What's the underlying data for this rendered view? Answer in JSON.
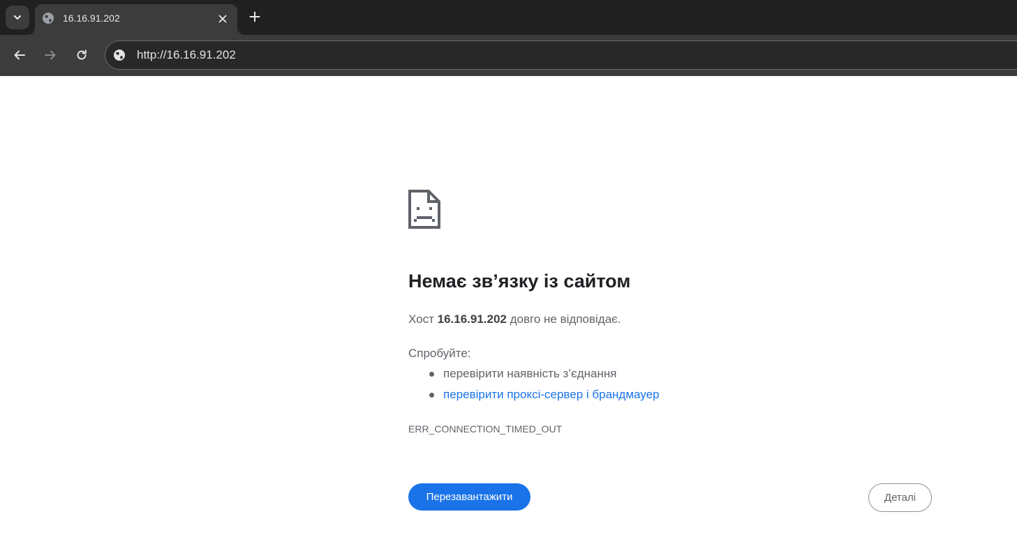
{
  "browser": {
    "tab": {
      "title": "16.16.91.202"
    },
    "address_bar": {
      "url": "http://16.16.91.202"
    },
    "colors": {
      "tabstrip": "#202020",
      "toolbar": "#3c3c3c",
      "omnibox": "#282828"
    }
  },
  "error_page": {
    "icon": "sad-page-icon",
    "title": "Немає зв’язку із сайтом",
    "host_prefix": "Хост",
    "host": "16.16.91.202",
    "host_suffix": "довго не відповідає.",
    "try_label": "Спробуйте:",
    "suggestions": [
      "перевірити наявність з’єднання",
      "перевірити проксі-сервер і брандмауер"
    ],
    "error_code": "ERR_CONNECTION_TIMED_OUT",
    "reload_label": "Перезавантажити",
    "details_label": "Деталі",
    "colors": {
      "primary_button": "#1a73e8",
      "link": "#1a73e8",
      "title": "#202124",
      "body_text": "#5f6368"
    }
  }
}
